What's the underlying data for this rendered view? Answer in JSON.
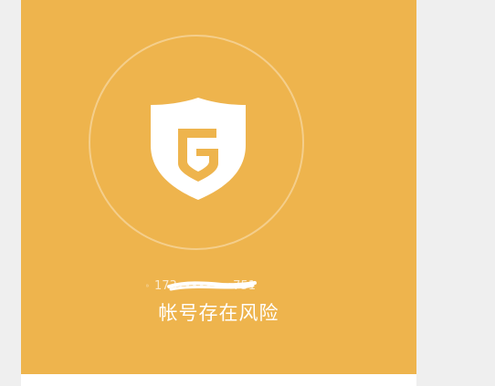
{
  "account": {
    "icon": "account-id-icon",
    "number": "173••••••••751"
  },
  "status": {
    "message": "帐号存在风险"
  },
  "colors": {
    "panel": "#eeb44d",
    "background": "#efefef"
  },
  "shield": {
    "icon": "shield-g-icon"
  }
}
